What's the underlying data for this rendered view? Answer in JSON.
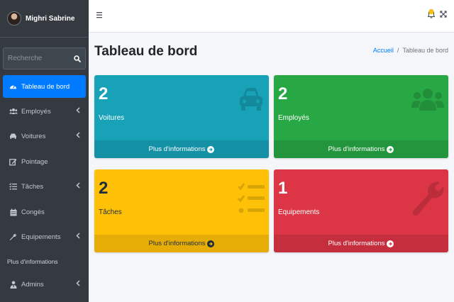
{
  "sidebar": {
    "user_name": "Mighri Sabrine",
    "search_placeholder": "Recherche",
    "items": [
      {
        "label": "Tableau de bord",
        "icon": "dashboard-icon",
        "active": true
      },
      {
        "label": "Employés",
        "icon": "users-icon",
        "chevron": true
      },
      {
        "label": "Voitures",
        "icon": "car-icon",
        "chevron": true
      },
      {
        "label": "Pointage",
        "icon": "edit-icon"
      },
      {
        "label": "Tâches",
        "icon": "tasks-icon",
        "chevron": true
      },
      {
        "label": "Congés",
        "icon": "calendar-icon"
      },
      {
        "label": "Equipements",
        "icon": "wrench-icon",
        "chevron": true
      }
    ],
    "header_label": "Plus d'informations",
    "admins_label": "Admins"
  },
  "page": {
    "title": "Tableau de bord",
    "breadcrumb": {
      "home": "Accueil",
      "separator": "/",
      "current": "Tableau de bord"
    }
  },
  "boxes": [
    {
      "value": "2",
      "label": "Voitures",
      "footer": "Plus d'informations",
      "color": "#17a2b8",
      "icon": "car-icon"
    },
    {
      "value": "2",
      "label": "Employés",
      "footer": "Plus d'informations",
      "color": "#28a745",
      "icon": "users-icon"
    },
    {
      "value": "2",
      "label": "Tâches",
      "footer": "Plus d'informations",
      "color": "#ffc107",
      "icon": "tasks-icon"
    },
    {
      "value": "1",
      "label": "Equipements",
      "footer": "Plus d'informations",
      "color": "#dc3545",
      "icon": "wrench-icon"
    }
  ]
}
